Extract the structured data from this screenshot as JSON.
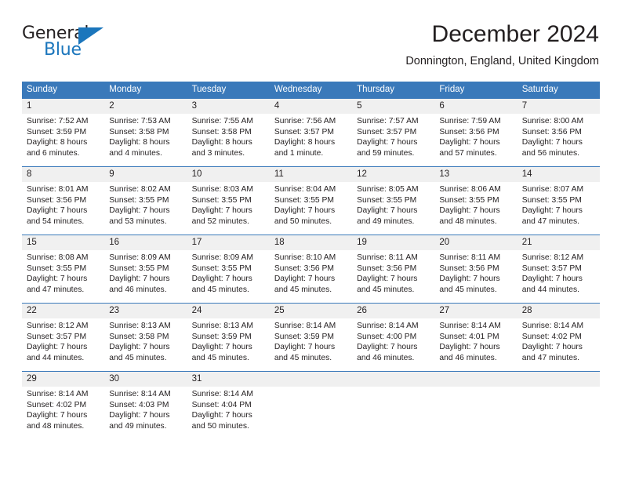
{
  "brand": {
    "name_part1": "General",
    "name_part2": "Blue",
    "accent_color": "#1b76bc"
  },
  "header": {
    "title": "December 2024",
    "subtitle": "Donnington, England, United Kingdom"
  },
  "calendar": {
    "header_color": "#3a79ba",
    "daynum_band_color": "#f0f0f0",
    "weekdays": [
      "Sunday",
      "Monday",
      "Tuesday",
      "Wednesday",
      "Thursday",
      "Friday",
      "Saturday"
    ],
    "weeks": [
      [
        {
          "day": "1",
          "sunrise": "Sunrise: 7:52 AM",
          "sunset": "Sunset: 3:59 PM",
          "daylight_line1": "Daylight: 8 hours",
          "daylight_line2": "and 6 minutes."
        },
        {
          "day": "2",
          "sunrise": "Sunrise: 7:53 AM",
          "sunset": "Sunset: 3:58 PM",
          "daylight_line1": "Daylight: 8 hours",
          "daylight_line2": "and 4 minutes."
        },
        {
          "day": "3",
          "sunrise": "Sunrise: 7:55 AM",
          "sunset": "Sunset: 3:58 PM",
          "daylight_line1": "Daylight: 8 hours",
          "daylight_line2": "and 3 minutes."
        },
        {
          "day": "4",
          "sunrise": "Sunrise: 7:56 AM",
          "sunset": "Sunset: 3:57 PM",
          "daylight_line1": "Daylight: 8 hours",
          "daylight_line2": "and 1 minute."
        },
        {
          "day": "5",
          "sunrise": "Sunrise: 7:57 AM",
          "sunset": "Sunset: 3:57 PM",
          "daylight_line1": "Daylight: 7 hours",
          "daylight_line2": "and 59 minutes."
        },
        {
          "day": "6",
          "sunrise": "Sunrise: 7:59 AM",
          "sunset": "Sunset: 3:56 PM",
          "daylight_line1": "Daylight: 7 hours",
          "daylight_line2": "and 57 minutes."
        },
        {
          "day": "7",
          "sunrise": "Sunrise: 8:00 AM",
          "sunset": "Sunset: 3:56 PM",
          "daylight_line1": "Daylight: 7 hours",
          "daylight_line2": "and 56 minutes."
        }
      ],
      [
        {
          "day": "8",
          "sunrise": "Sunrise: 8:01 AM",
          "sunset": "Sunset: 3:56 PM",
          "daylight_line1": "Daylight: 7 hours",
          "daylight_line2": "and 54 minutes."
        },
        {
          "day": "9",
          "sunrise": "Sunrise: 8:02 AM",
          "sunset": "Sunset: 3:55 PM",
          "daylight_line1": "Daylight: 7 hours",
          "daylight_line2": "and 53 minutes."
        },
        {
          "day": "10",
          "sunrise": "Sunrise: 8:03 AM",
          "sunset": "Sunset: 3:55 PM",
          "daylight_line1": "Daylight: 7 hours",
          "daylight_line2": "and 52 minutes."
        },
        {
          "day": "11",
          "sunrise": "Sunrise: 8:04 AM",
          "sunset": "Sunset: 3:55 PM",
          "daylight_line1": "Daylight: 7 hours",
          "daylight_line2": "and 50 minutes."
        },
        {
          "day": "12",
          "sunrise": "Sunrise: 8:05 AM",
          "sunset": "Sunset: 3:55 PM",
          "daylight_line1": "Daylight: 7 hours",
          "daylight_line2": "and 49 minutes."
        },
        {
          "day": "13",
          "sunrise": "Sunrise: 8:06 AM",
          "sunset": "Sunset: 3:55 PM",
          "daylight_line1": "Daylight: 7 hours",
          "daylight_line2": "and 48 minutes."
        },
        {
          "day": "14",
          "sunrise": "Sunrise: 8:07 AM",
          "sunset": "Sunset: 3:55 PM",
          "daylight_line1": "Daylight: 7 hours",
          "daylight_line2": "and 47 minutes."
        }
      ],
      [
        {
          "day": "15",
          "sunrise": "Sunrise: 8:08 AM",
          "sunset": "Sunset: 3:55 PM",
          "daylight_line1": "Daylight: 7 hours",
          "daylight_line2": "and 47 minutes."
        },
        {
          "day": "16",
          "sunrise": "Sunrise: 8:09 AM",
          "sunset": "Sunset: 3:55 PM",
          "daylight_line1": "Daylight: 7 hours",
          "daylight_line2": "and 46 minutes."
        },
        {
          "day": "17",
          "sunrise": "Sunrise: 8:09 AM",
          "sunset": "Sunset: 3:55 PM",
          "daylight_line1": "Daylight: 7 hours",
          "daylight_line2": "and 45 minutes."
        },
        {
          "day": "18",
          "sunrise": "Sunrise: 8:10 AM",
          "sunset": "Sunset: 3:56 PM",
          "daylight_line1": "Daylight: 7 hours",
          "daylight_line2": "and 45 minutes."
        },
        {
          "day": "19",
          "sunrise": "Sunrise: 8:11 AM",
          "sunset": "Sunset: 3:56 PM",
          "daylight_line1": "Daylight: 7 hours",
          "daylight_line2": "and 45 minutes."
        },
        {
          "day": "20",
          "sunrise": "Sunrise: 8:11 AM",
          "sunset": "Sunset: 3:56 PM",
          "daylight_line1": "Daylight: 7 hours",
          "daylight_line2": "and 45 minutes."
        },
        {
          "day": "21",
          "sunrise": "Sunrise: 8:12 AM",
          "sunset": "Sunset: 3:57 PM",
          "daylight_line1": "Daylight: 7 hours",
          "daylight_line2": "and 44 minutes."
        }
      ],
      [
        {
          "day": "22",
          "sunrise": "Sunrise: 8:12 AM",
          "sunset": "Sunset: 3:57 PM",
          "daylight_line1": "Daylight: 7 hours",
          "daylight_line2": "and 44 minutes."
        },
        {
          "day": "23",
          "sunrise": "Sunrise: 8:13 AM",
          "sunset": "Sunset: 3:58 PM",
          "daylight_line1": "Daylight: 7 hours",
          "daylight_line2": "and 45 minutes."
        },
        {
          "day": "24",
          "sunrise": "Sunrise: 8:13 AM",
          "sunset": "Sunset: 3:59 PM",
          "daylight_line1": "Daylight: 7 hours",
          "daylight_line2": "and 45 minutes."
        },
        {
          "day": "25",
          "sunrise": "Sunrise: 8:14 AM",
          "sunset": "Sunset: 3:59 PM",
          "daylight_line1": "Daylight: 7 hours",
          "daylight_line2": "and 45 minutes."
        },
        {
          "day": "26",
          "sunrise": "Sunrise: 8:14 AM",
          "sunset": "Sunset: 4:00 PM",
          "daylight_line1": "Daylight: 7 hours",
          "daylight_line2": "and 46 minutes."
        },
        {
          "day": "27",
          "sunrise": "Sunrise: 8:14 AM",
          "sunset": "Sunset: 4:01 PM",
          "daylight_line1": "Daylight: 7 hours",
          "daylight_line2": "and 46 minutes."
        },
        {
          "day": "28",
          "sunrise": "Sunrise: 8:14 AM",
          "sunset": "Sunset: 4:02 PM",
          "daylight_line1": "Daylight: 7 hours",
          "daylight_line2": "and 47 minutes."
        }
      ],
      [
        {
          "day": "29",
          "sunrise": "Sunrise: 8:14 AM",
          "sunset": "Sunset: 4:02 PM",
          "daylight_line1": "Daylight: 7 hours",
          "daylight_line2": "and 48 minutes."
        },
        {
          "day": "30",
          "sunrise": "Sunrise: 8:14 AM",
          "sunset": "Sunset: 4:03 PM",
          "daylight_line1": "Daylight: 7 hours",
          "daylight_line2": "and 49 minutes."
        },
        {
          "day": "31",
          "sunrise": "Sunrise: 8:14 AM",
          "sunset": "Sunset: 4:04 PM",
          "daylight_line1": "Daylight: 7 hours",
          "daylight_line2": "and 50 minutes."
        },
        {
          "day": "",
          "sunrise": "",
          "sunset": "",
          "daylight_line1": "",
          "daylight_line2": ""
        },
        {
          "day": "",
          "sunrise": "",
          "sunset": "",
          "daylight_line1": "",
          "daylight_line2": ""
        },
        {
          "day": "",
          "sunrise": "",
          "sunset": "",
          "daylight_line1": "",
          "daylight_line2": ""
        },
        {
          "day": "",
          "sunrise": "",
          "sunset": "",
          "daylight_line1": "",
          "daylight_line2": ""
        }
      ]
    ]
  }
}
